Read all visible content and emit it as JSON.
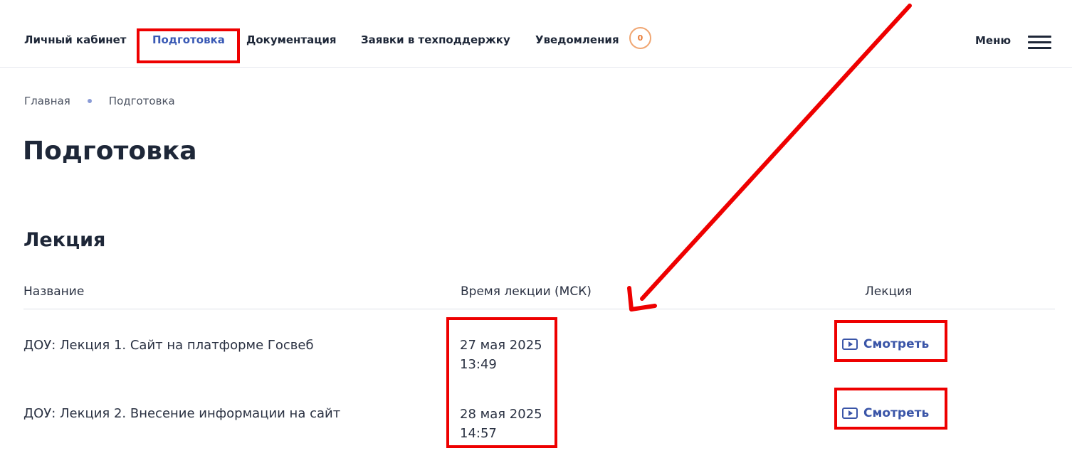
{
  "topnav": {
    "items": [
      {
        "label": "Личный кабинет"
      },
      {
        "label": "Подготовка"
      },
      {
        "label": "Документация"
      },
      {
        "label": "Заявки в техподдержку"
      },
      {
        "label": "Уведомления"
      }
    ],
    "notifications_count": "0",
    "menu_label": "Меню"
  },
  "breadcrumb": [
    "Главная",
    "Подготовка"
  ],
  "page_title": "Подготовка",
  "section_title": "Лекция",
  "table": {
    "headers": [
      "Название",
      "Время лекции (МСК)",
      "Лекция"
    ],
    "rows": [
      {
        "name": "ДОУ: Лекция 1. Сайт на платформе Госвеб",
        "date": "27 мая 2025",
        "time": "13:49",
        "action": "Смотреть"
      },
      {
        "name": "ДОУ: Лекция 2. Внесение информации на сайт",
        "date": "28 мая 2025",
        "time": "14:57",
        "action": "Смотреть"
      }
    ]
  },
  "icons": {
    "play": "play-icon",
    "burger": "hamburger-menu-icon",
    "breadcrumb_separator": "dot"
  },
  "colors": {
    "accent": "#3a55a8",
    "annotation": "#ee0000",
    "badge": "#f0a672"
  }
}
